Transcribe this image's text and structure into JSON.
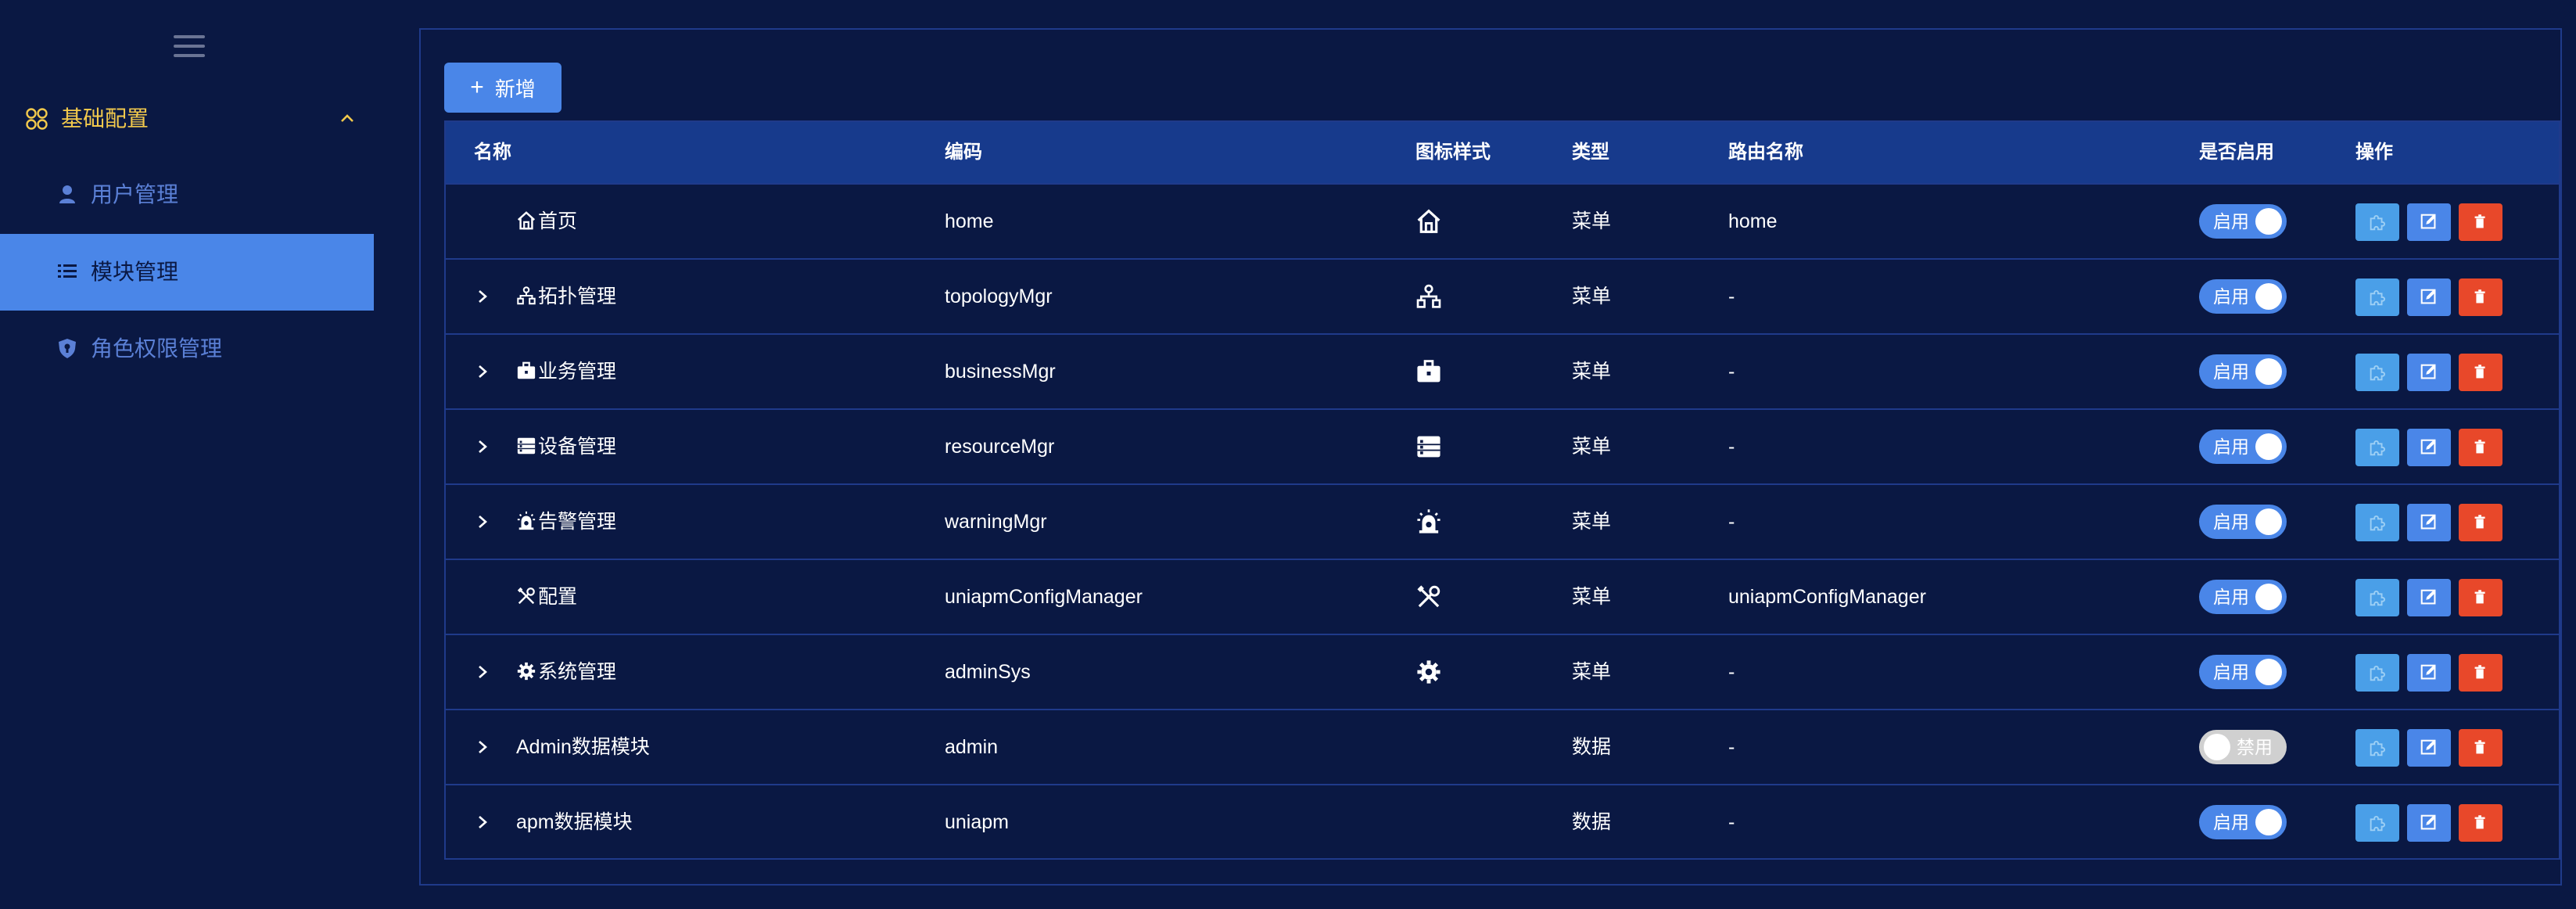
{
  "sidebar": {
    "menu_icon": "hamburger-icon",
    "group": {
      "label": "基础配置",
      "icon": "apps-icon",
      "expanded": true
    },
    "items": [
      {
        "label": "用户管理",
        "icon": "user-icon",
        "active": false
      },
      {
        "label": "模块管理",
        "icon": "list-icon",
        "active": true
      },
      {
        "label": "角色权限管理",
        "icon": "shield-icon",
        "active": false
      }
    ]
  },
  "toolbar": {
    "add_label": "新增",
    "add_icon": "plus-icon"
  },
  "table": {
    "headers": {
      "name": "名称",
      "code": "编码",
      "icon_style": "图标样式",
      "type": "类型",
      "route": "路由名称",
      "enabled": "是否启用",
      "actions": "操作"
    },
    "rows": [
      {
        "name": "首页",
        "icon": "home-icon",
        "expandable": false,
        "code": "home",
        "type": "菜单",
        "route": "home",
        "enabled": true,
        "status": "启用"
      },
      {
        "name": "拓扑管理",
        "icon": "topology-icon",
        "expandable": true,
        "code": "topologyMgr",
        "type": "菜单",
        "route": "-",
        "enabled": true,
        "status": "启用"
      },
      {
        "name": "业务管理",
        "icon": "briefcase-icon",
        "expandable": true,
        "code": "businessMgr",
        "type": "菜单",
        "route": "-",
        "enabled": true,
        "status": "启用"
      },
      {
        "name": "设备管理",
        "icon": "server-icon",
        "expandable": true,
        "code": "resourceMgr",
        "type": "菜单",
        "route": "-",
        "enabled": true,
        "status": "启用"
      },
      {
        "name": "告警管理",
        "icon": "alarm-icon",
        "expandable": true,
        "code": "warningMgr",
        "type": "菜单",
        "route": "-",
        "enabled": true,
        "status": "启用"
      },
      {
        "name": "配置",
        "icon": "tools-icon",
        "expandable": false,
        "code": "uniapmConfigManager",
        "type": "菜单",
        "route": "uniapmConfigManager",
        "enabled": true,
        "status": "启用"
      },
      {
        "name": "系统管理",
        "icon": "gear-icon",
        "expandable": true,
        "code": "adminSys",
        "type": "菜单",
        "route": "-",
        "enabled": true,
        "status": "启用"
      },
      {
        "name": "Admin数据模块",
        "icon": "",
        "expandable": true,
        "code": "admin",
        "type": "数据",
        "route": "-",
        "enabled": false,
        "status": "禁用"
      },
      {
        "name": "apm数据模块",
        "icon": "",
        "expandable": true,
        "code": "uniapm",
        "type": "数据",
        "route": "-",
        "enabled": true,
        "status": "启用"
      }
    ],
    "row_actions": [
      "puzzle-icon",
      "edit-icon",
      "trash-icon"
    ]
  },
  "colors": {
    "background": "#0a1843",
    "header": "#173a8c",
    "accent": "#4a86e8",
    "danger": "#e8482a",
    "group_label": "#f2c94c"
  }
}
